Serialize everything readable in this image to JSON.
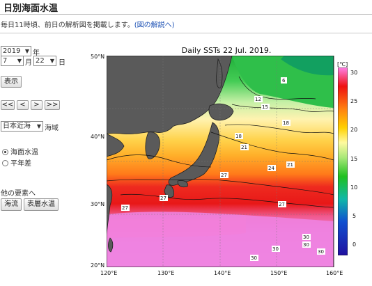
{
  "header": {
    "title": "日別海面水温"
  },
  "description": {
    "text": "毎日11時頃、前日の解析図を掲載します。",
    "link": "(図の解説へ)"
  },
  "date_controls": {
    "year": "2019",
    "year_suffix": "年",
    "month": "7",
    "month_suffix": "月",
    "day": "22",
    "day_suffix": "日",
    "show_button": "表示",
    "nav": [
      "<<",
      "<",
      ">",
      ">>"
    ]
  },
  "region": {
    "selected": "日本近海",
    "label": "海域"
  },
  "layers": [
    {
      "label": "海面水温",
      "selected": true
    },
    {
      "label": "平年差",
      "selected": false
    }
  ],
  "other": {
    "label": "他の要素へ",
    "buttons": [
      "海流",
      "表層水温"
    ]
  },
  "map": {
    "title": "Daily SSTs 22 Jul. 2019.",
    "lat_labels": [
      "50°N",
      "40°N",
      "30°N",
      "20°N"
    ],
    "lon_labels": [
      "120°E",
      "130°E",
      "140°E",
      "150°E",
      "160°E"
    ],
    "colorbar_unit": "[℃]",
    "colorbar_ticks": [
      "30",
      "25",
      "20",
      "15",
      "10",
      "5",
      "0"
    ],
    "contour_labels": [
      "6",
      "12",
      "15",
      "18",
      "18",
      "21",
      "21",
      "24",
      "27",
      "27",
      "27",
      "27",
      "30",
      "30",
      "30",
      "30",
      "30"
    ]
  },
  "colors": {
    "link": "#1a4fb3",
    "land": "#5a5a5a",
    "warm_pink": "#ee82e0",
    "red": "#ee2222",
    "orange": "#f5a623"
  }
}
